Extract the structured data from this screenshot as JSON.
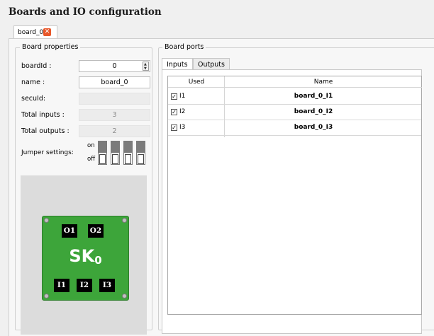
{
  "page": {
    "title": "Boards and IO configuration"
  },
  "tab": {
    "label": "board_0",
    "close": "✕"
  },
  "board_properties": {
    "title": "Board properties",
    "boardId": {
      "label": "boardId :",
      "value": "0"
    },
    "name": {
      "label": "name :",
      "value": "board_0"
    },
    "secuId": {
      "label": "secuId:",
      "value": ""
    },
    "total_inputs": {
      "label": "Total inputs :",
      "value": "3"
    },
    "total_outputs": {
      "label": "Total outputs :",
      "value": "2"
    },
    "jumper": {
      "label": "Jumper settings:",
      "on": "on",
      "off": "off",
      "count": 4
    }
  },
  "board_graphic": {
    "outputs": [
      "O1",
      "O2"
    ],
    "name": "SK",
    "subscript": "0",
    "inputs": [
      "I1",
      "I2",
      "I3"
    ],
    "color": "#3da53a"
  },
  "board_ports": {
    "title": "Board ports",
    "tabs": [
      {
        "label": "Inputs",
        "active": true
      },
      {
        "label": "Outputs",
        "active": false
      }
    ],
    "columns": [
      "Used",
      "Name"
    ],
    "rows": [
      {
        "used": true,
        "id": "I1",
        "name": "board_0_I1"
      },
      {
        "used": true,
        "id": "I2",
        "name": "board_0_I2"
      },
      {
        "used": true,
        "id": "I3",
        "name": "board_0_I3"
      }
    ]
  }
}
